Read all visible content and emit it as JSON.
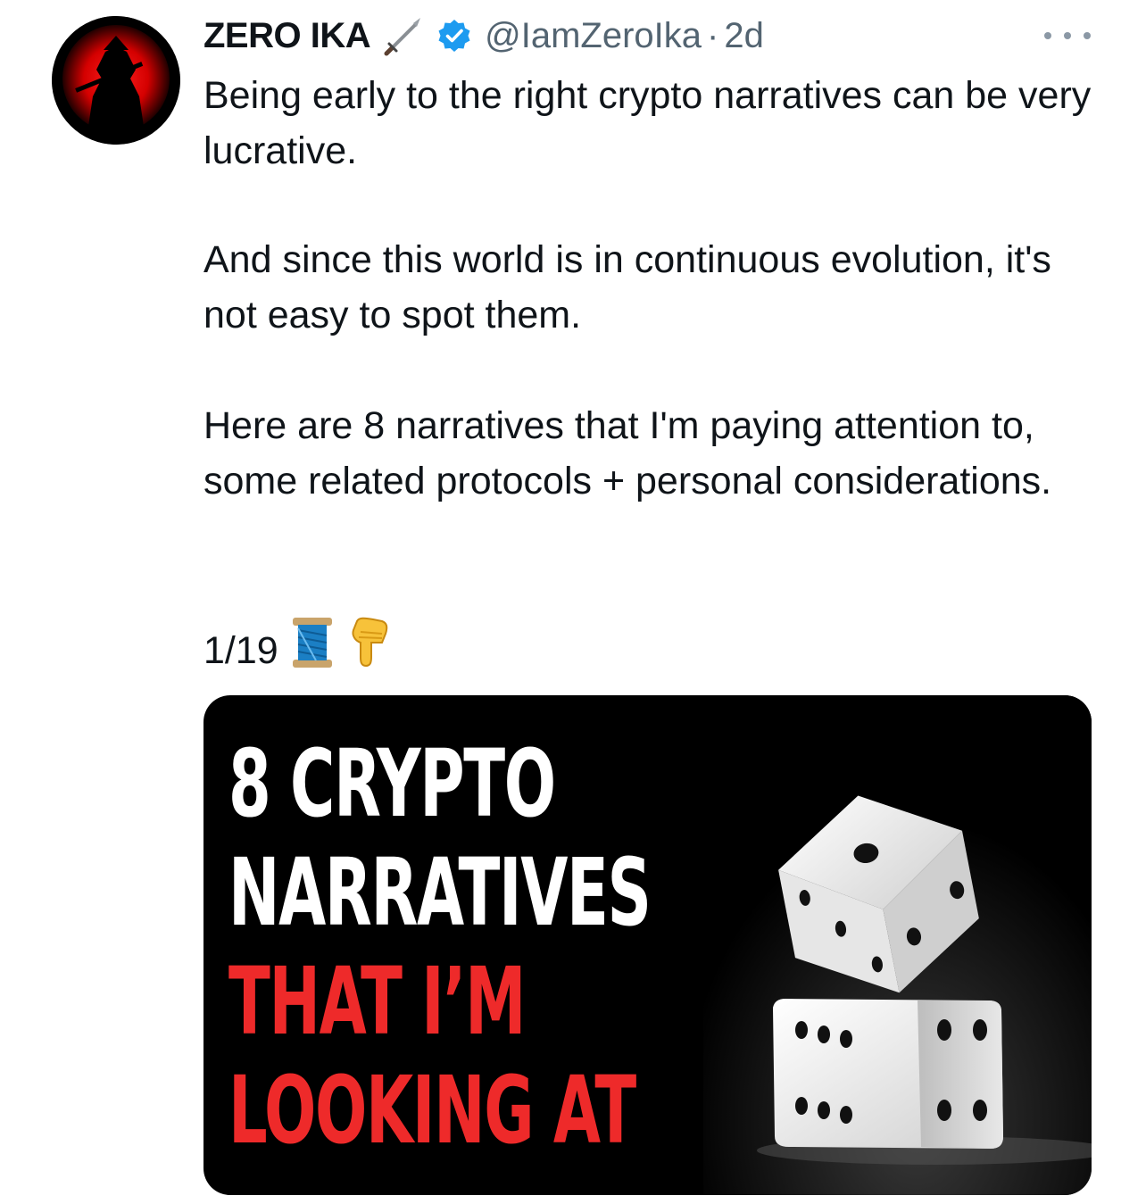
{
  "tweet": {
    "author_name": "ZERO IKA",
    "author_handle": "@IamZeroIka",
    "separator": "·",
    "age": "2d",
    "paragraphs": [
      "Being early to the right crypto narratives can be very lucrative.",
      "And since this world is in continuous evolution, it's not easy to spot them.",
      "Here are 8 narratives that I'm paying attention to, some related protocols + personal considerations."
    ],
    "thread_counter": "1/19",
    "emojis": [
      "spool-of-thread-icon",
      "hand-pointing-down-icon"
    ]
  },
  "media": {
    "line1": "8 CRYPTO",
    "line2": "NARRATIVES",
    "line3": "THAT I’M",
    "line4": "LOOKING AT",
    "colors": {
      "white": "#ffffff",
      "red": "#ee2a2a",
      "background": "#000000"
    }
  },
  "colors": {
    "text": "#0f1419",
    "secondary": "#536471",
    "verified": "#1d9bf0"
  }
}
